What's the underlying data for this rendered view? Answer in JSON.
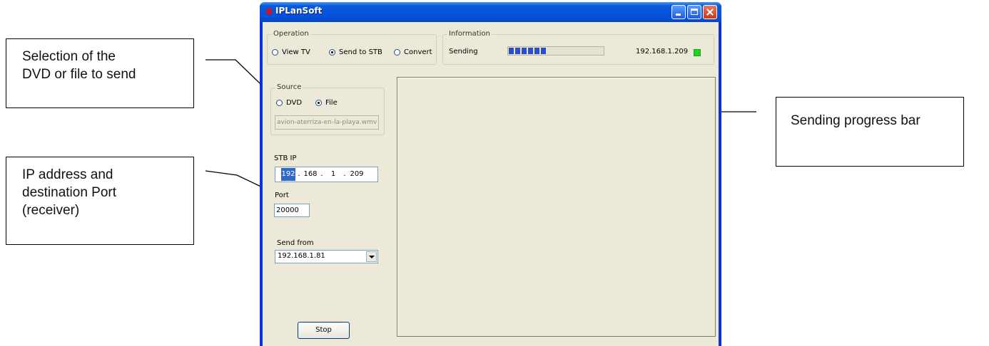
{
  "callouts": {
    "source": [
      "Selection of the",
      "DVD or file to send"
    ],
    "network": [
      "IP address and",
      "destination Port",
      "(receiver)"
    ],
    "progress": [
      "Sending progress bar"
    ]
  },
  "window": {
    "title": "IPLanSoft",
    "operation": {
      "legend": "Operation",
      "options": [
        "View TV",
        "Send to STB",
        "Convert"
      ],
      "selected": "Send to STB"
    },
    "information": {
      "legend": "Information",
      "status": "Sending",
      "progress": 0.4,
      "ip": "192.168.1.209",
      "led_color": "#22d322"
    },
    "source": {
      "legend": "Source",
      "options": [
        "DVD",
        "File"
      ],
      "selected": "File",
      "file": "avion-aterriza-en-la-playa.wmv"
    },
    "stb_ip": {
      "label": "STB IP",
      "octets": [
        "192",
        "168",
        "1",
        "209"
      ],
      "separator": "."
    },
    "port": {
      "label": "Port",
      "value": "20000"
    },
    "send_from": {
      "label": "Send from",
      "value": "192.168.1.81"
    },
    "stop_label": "Stop"
  }
}
